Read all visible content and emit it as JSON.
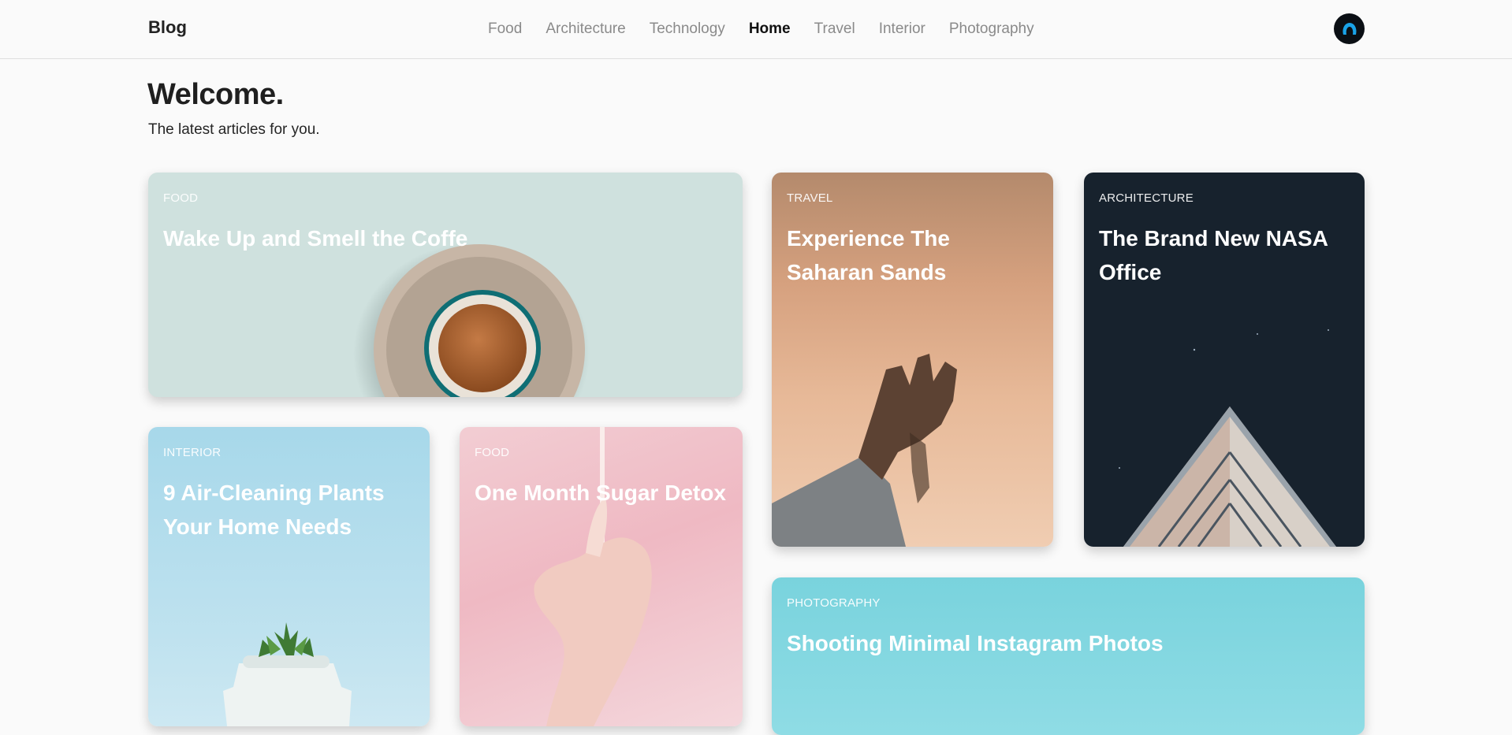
{
  "header": {
    "brand": "Blog",
    "nav": [
      "Food",
      "Architecture",
      "Technology",
      "Home",
      "Travel",
      "Interior",
      "Photography"
    ],
    "active": "Home"
  },
  "intro": {
    "title": "Welcome.",
    "subtitle": "The latest articles for you."
  },
  "cards": {
    "coffee": {
      "tag": "FOOD",
      "title": "Wake Up and Smell the Coffe"
    },
    "sahara": {
      "tag": "TRAVEL",
      "title": "Experience The Saharan Sands"
    },
    "nasa": {
      "tag": "ARCHITECTURE",
      "title": "The Brand New NASA Office"
    },
    "plants": {
      "tag": "INTERIOR",
      "title": "9 Air-Cleaning Plants Your Home Needs"
    },
    "sugar": {
      "tag": "FOOD",
      "title": "One Month Sugar Detox"
    },
    "photo": {
      "tag": "PHOTOGRAPHY",
      "title": "Shooting Minimal Instagram Photos"
    }
  },
  "colors": {
    "accent": "#1aa3e8",
    "background": "#fafafa",
    "active_nav": "#111111",
    "inactive_nav": "#8a8a8a"
  }
}
